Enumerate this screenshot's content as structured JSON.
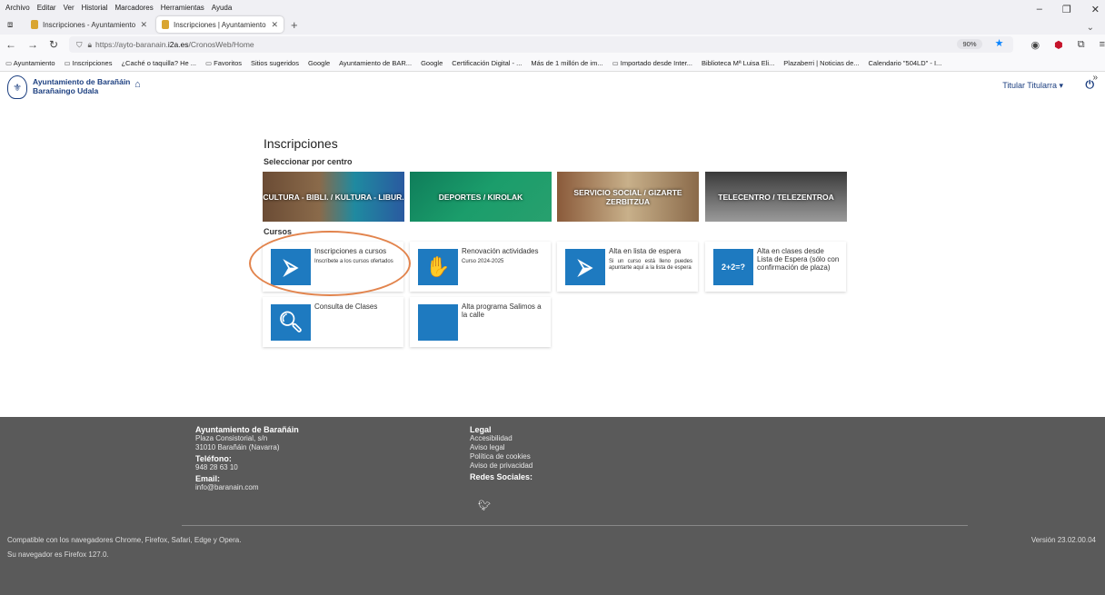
{
  "browser": {
    "menu": [
      "Archivo",
      "Editar",
      "Ver",
      "Historial",
      "Marcadores",
      "Herramientas",
      "Ayuda"
    ],
    "tabs": [
      {
        "title": "Inscripciones - Ayuntamiento d"
      },
      {
        "title": "Inscripciones | Ayuntamiento d"
      }
    ],
    "url_prefix": "https://ayto-baranain.",
    "url_domain": "i2a.es",
    "url_path": "/CronosWeb/Home",
    "zoom": "90%",
    "bookmarks": [
      "Ayuntamiento",
      "Inscripciones",
      "¿Caché o taquilla? He ...",
      "Favoritos",
      "Sitios sugeridos",
      "Google",
      "Ayuntamiento de BAR...",
      "Google",
      "Certificación Digital - ...",
      "Más de 1 millón de im...",
      "Importado desde Inter...",
      "Biblioteca Mª Luisa Eli...",
      "Plazaberri | Noticias de...",
      "Calendario \"504LD\" - I..."
    ]
  },
  "header": {
    "org_line1": "Ayuntamiento de Barañáin",
    "org_line2": "Barañaingo Udala",
    "user": "Titular Titularra"
  },
  "main": {
    "title": "Inscripciones",
    "centro_label": "Seleccionar por centro",
    "centros": [
      "CULTURA - BIBLI. / KULTURA - LIBUR.",
      "DEPORTES / KIROLAK",
      "SERVICIO SOCIAL / GIZARTE ZERBITZUA",
      "TELECENTRO / TELEZENTROA"
    ],
    "cursos_label": "Cursos",
    "cards": [
      {
        "title": "Inscripciones a cursos",
        "sub": "Inscríbete a los cursos ofertados"
      },
      {
        "title": "Renovación actividades",
        "sub": "Curso 2024-2025"
      },
      {
        "title": "Alta en lista de espera",
        "sub": "Si un curso está lleno puedes apuntarte aquí a la lista de espera"
      },
      {
        "title": "Alta en clases desde Lista de Espera (sólo con confirmación de plaza)",
        "sub": ""
      },
      {
        "title": "Consulta de Clases",
        "sub": ""
      },
      {
        "title": "Alta programa Salimos a la calle",
        "sub": ""
      }
    ],
    "card4_icon_text": "2+2=?"
  },
  "footer": {
    "org": "Ayuntamiento de Barañáin",
    "addr1": "Plaza Consistorial, s/n",
    "addr2": "31010 Barañáin (Navarra)",
    "tel_label": "Teléfono:",
    "tel": "948 28 63 10",
    "email_label": "Email:",
    "email": "info@baranain.com",
    "legal_label": "Legal",
    "legal_links": [
      "Accesibilidad",
      "Aviso legal",
      "Política de cookies",
      "Aviso de privacidad"
    ],
    "social_label": "Redes Sociales:",
    "compat": "Compatible con los navegadores Chrome, Firefox, Safari, Edge y Opera.",
    "nav": "Su navegador es Firefox 127.0.",
    "version": "Versión 23.02.00.04"
  }
}
